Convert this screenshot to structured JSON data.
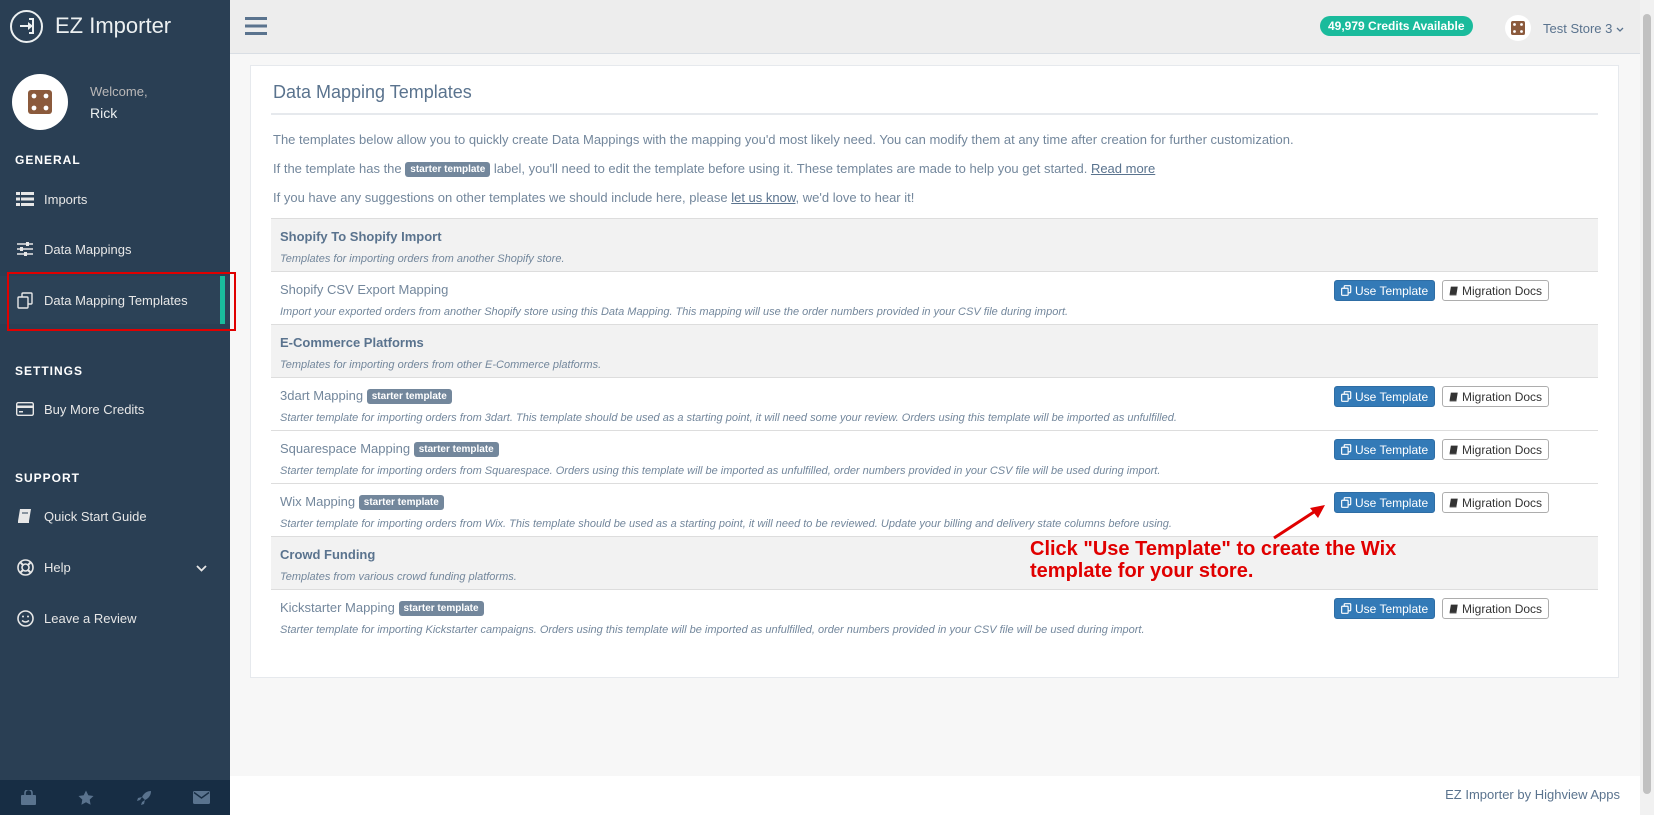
{
  "app": {
    "title": "EZ Importer"
  },
  "profile": {
    "welcome_label": "Welcome,",
    "name": "Rick"
  },
  "sidebar": {
    "general_title": "GENERAL",
    "settings_title": "SETTINGS",
    "support_title": "SUPPORT",
    "items": [
      {
        "label": "Imports",
        "icon": "list-icon"
      },
      {
        "label": "Data Mappings",
        "icon": "sliders-icon"
      },
      {
        "label": "Data Mapping Templates",
        "icon": "copy-icon",
        "active": true
      },
      {
        "label": "Buy More Credits",
        "icon": "credit-card-icon"
      },
      {
        "label": "Quick Start Guide",
        "icon": "book-icon"
      },
      {
        "label": "Help",
        "icon": "lifebuoy-icon"
      },
      {
        "label": "Leave a Review",
        "icon": "smile-icon"
      }
    ],
    "footer_icons": [
      "shopping-bag-icon",
      "star-icon",
      "rocket-icon",
      "envelope-icon"
    ]
  },
  "topnav": {
    "credits": "49,979 Credits Available",
    "store_name": "Test Store 3"
  },
  "panel": {
    "title": "Data Mapping Templates",
    "intro1": "The templates below allow you to quickly create Data Mappings with the mapping you'd most likely need. You can modify them at any time after creation for further customization.",
    "intro2_before": "If the template has the",
    "intro2_after": "label, you'll need to edit the template before using it. These templates are made to help you get started.",
    "intro2_link": "Read more",
    "intro3_before": "If you have any suggestions on other templates we should include here, please",
    "intro3_link": "let us know",
    "intro3_after": ", we'd love to hear it!",
    "starter_badge": "starter template",
    "use_template_label": "Use Template",
    "migration_docs_label": "Migration Docs"
  },
  "rows": [
    {
      "name": "Shopify To Shopify Import",
      "desc": "Templates for importing orders from another Shopify store."
    },
    {
      "name": "Shopify CSV Export Mapping",
      "desc": "Import your exported orders from another Shopify store using this Data Mapping. This mapping will use the order numbers provided in your CSV file during import."
    },
    {
      "name": "E-Commerce Platforms",
      "desc": "Templates for importing orders from other E-Commerce platforms."
    },
    {
      "name": "3dart Mapping",
      "desc": "Starter template for importing orders from 3dart. This template should be used as a starting point, it will need some your review. Orders using this template will be imported as unfulfilled."
    },
    {
      "name": "Squarespace Mapping",
      "desc": "Starter template for importing orders from Squarespace. Orders using this template will be imported as unfulfilled, order numbers provided in your CSV file will be used during import."
    },
    {
      "name": "Wix Mapping",
      "desc": "Starter template for importing orders from Wix. This template should be used as a starting point, it will need to be reviewed. Update your billing and delivery state columns before using."
    },
    {
      "name": "Crowd Funding",
      "desc": "Templates from various crowd funding platforms."
    },
    {
      "name": "Kickstarter Mapping",
      "desc": "Starter template for importing Kickstarter campaigns. Orders using this template will be imported as unfulfilled, order numbers provided in your CSV file will be used during import."
    }
  ],
  "annotation": "Click \"Use Template\" to create the Wix template for your store.",
  "footer": "EZ Importer by Highview Apps",
  "colors": {
    "sidebar": "#2a3f54",
    "accent": "#1abb9c",
    "button_primary": "#337ab7",
    "annotation": "#e00000"
  }
}
